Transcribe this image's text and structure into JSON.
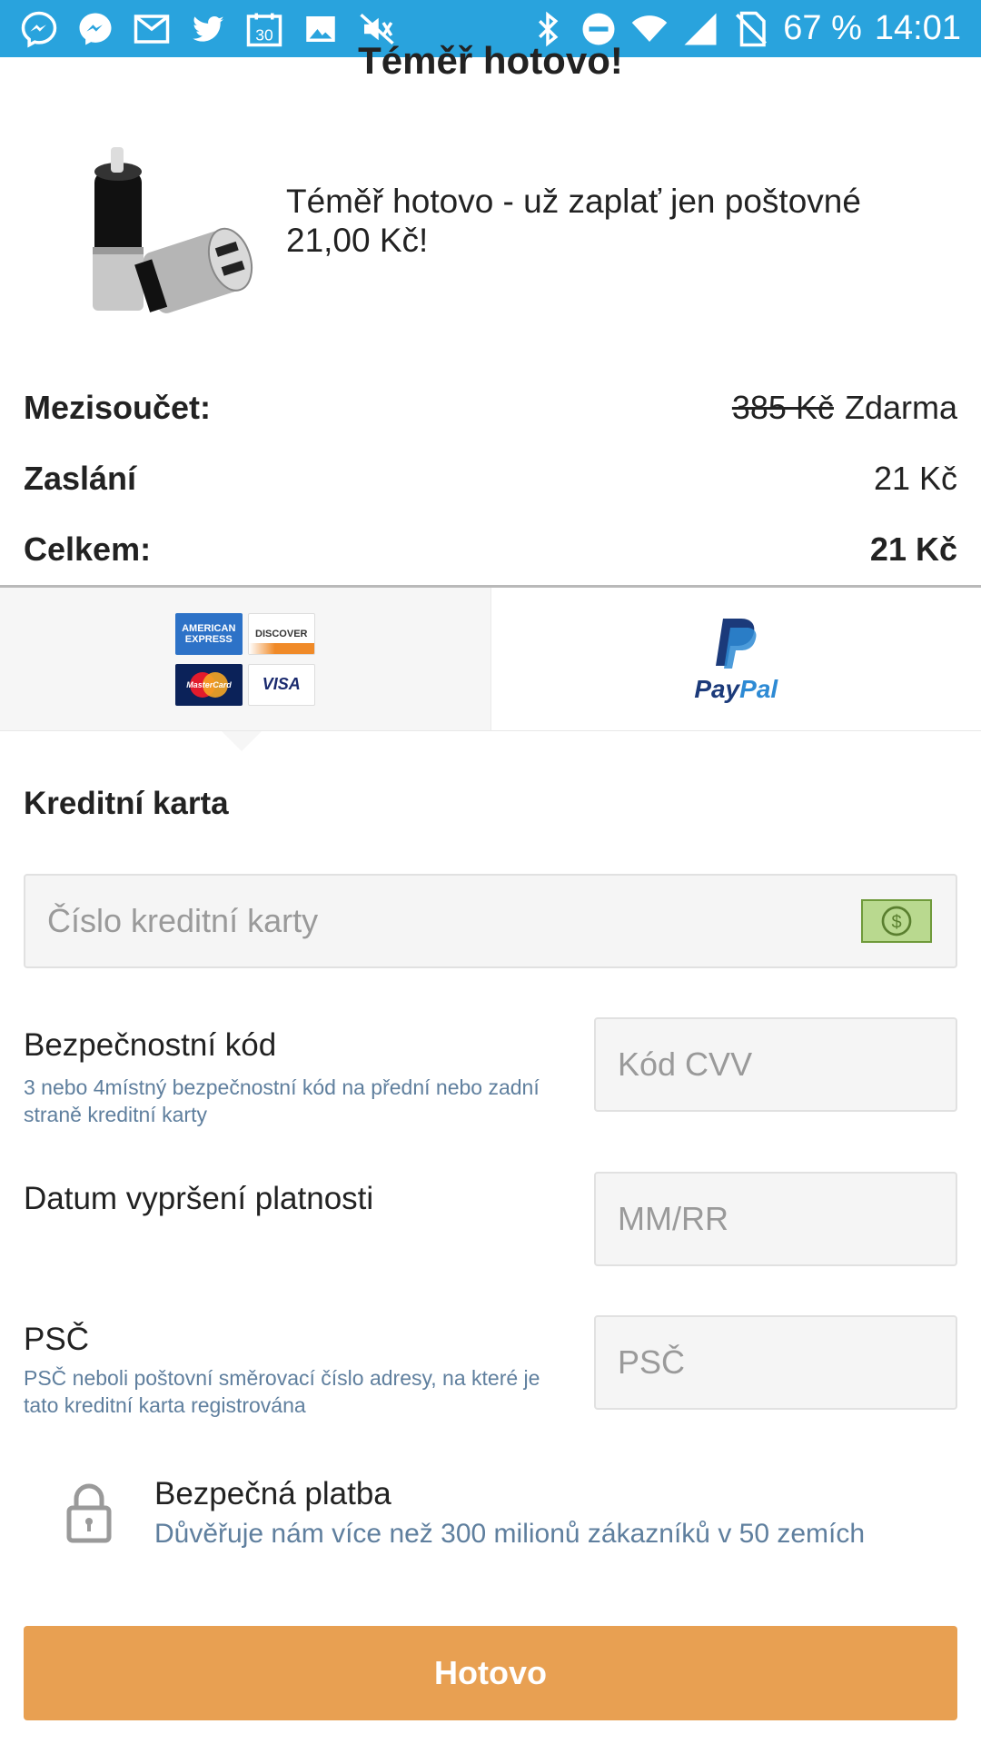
{
  "status_bar": {
    "battery": "67 %",
    "time": "14:01",
    "calendar_day": "30",
    "icons": [
      "messenger-icon",
      "messenger-icon",
      "gmail-icon",
      "twitter-icon",
      "calendar-icon",
      "gallery-icon",
      "mute-icon",
      "bluetooth-icon",
      "dnd-icon",
      "wifi-icon",
      "signal-icon",
      "no-sim-icon"
    ]
  },
  "page": {
    "heading": "Téměř hotovo!"
  },
  "product": {
    "message": "Téměř hotovo - už zaplať jen poštovné 21,00 Kč!"
  },
  "summary": {
    "subtotal_label": "Mezisoučet:",
    "subtotal_old": "385 Kč",
    "subtotal_value": "Zdarma",
    "shipping_label": "Zaslání",
    "shipping_value": "21 Kč",
    "total_label": "Celkem:",
    "total_value": "21 Kč"
  },
  "payment_tabs": {
    "cards": {
      "amex": "AMERICAN EXPRESS",
      "discover": "DISCOVER",
      "mastercard": "MasterCard",
      "visa": "VISA"
    },
    "paypal": {
      "pay": "Pay",
      "pal": "Pal"
    }
  },
  "form": {
    "section_title": "Kreditní karta",
    "card_number_placeholder": "Číslo kreditní karty",
    "security_label": "Bezpečnostní kód",
    "security_help": "3 nebo 4místný bezpečnostní kód na přední nebo zadní straně kreditní karty",
    "cvv_placeholder": "Kód CVV",
    "expiry_label": "Datum vypršení platnosti",
    "expiry_placeholder": "MM/RR",
    "zip_label": "PSČ",
    "zip_help": "PSČ neboli poštovní směrovací číslo adresy, na které je tato kreditní karta registrována",
    "zip_placeholder": "PSČ"
  },
  "secure": {
    "title": "Bezpečná platba",
    "subtitle": "Důvěřuje nám více než 300 milionů zákazníků v 50 zemích"
  },
  "actions": {
    "done_label": "Hotovo"
  },
  "colors": {
    "status_bar": "#29a3dd",
    "button": "#e8a052",
    "help_text": "#5f7f9e"
  }
}
